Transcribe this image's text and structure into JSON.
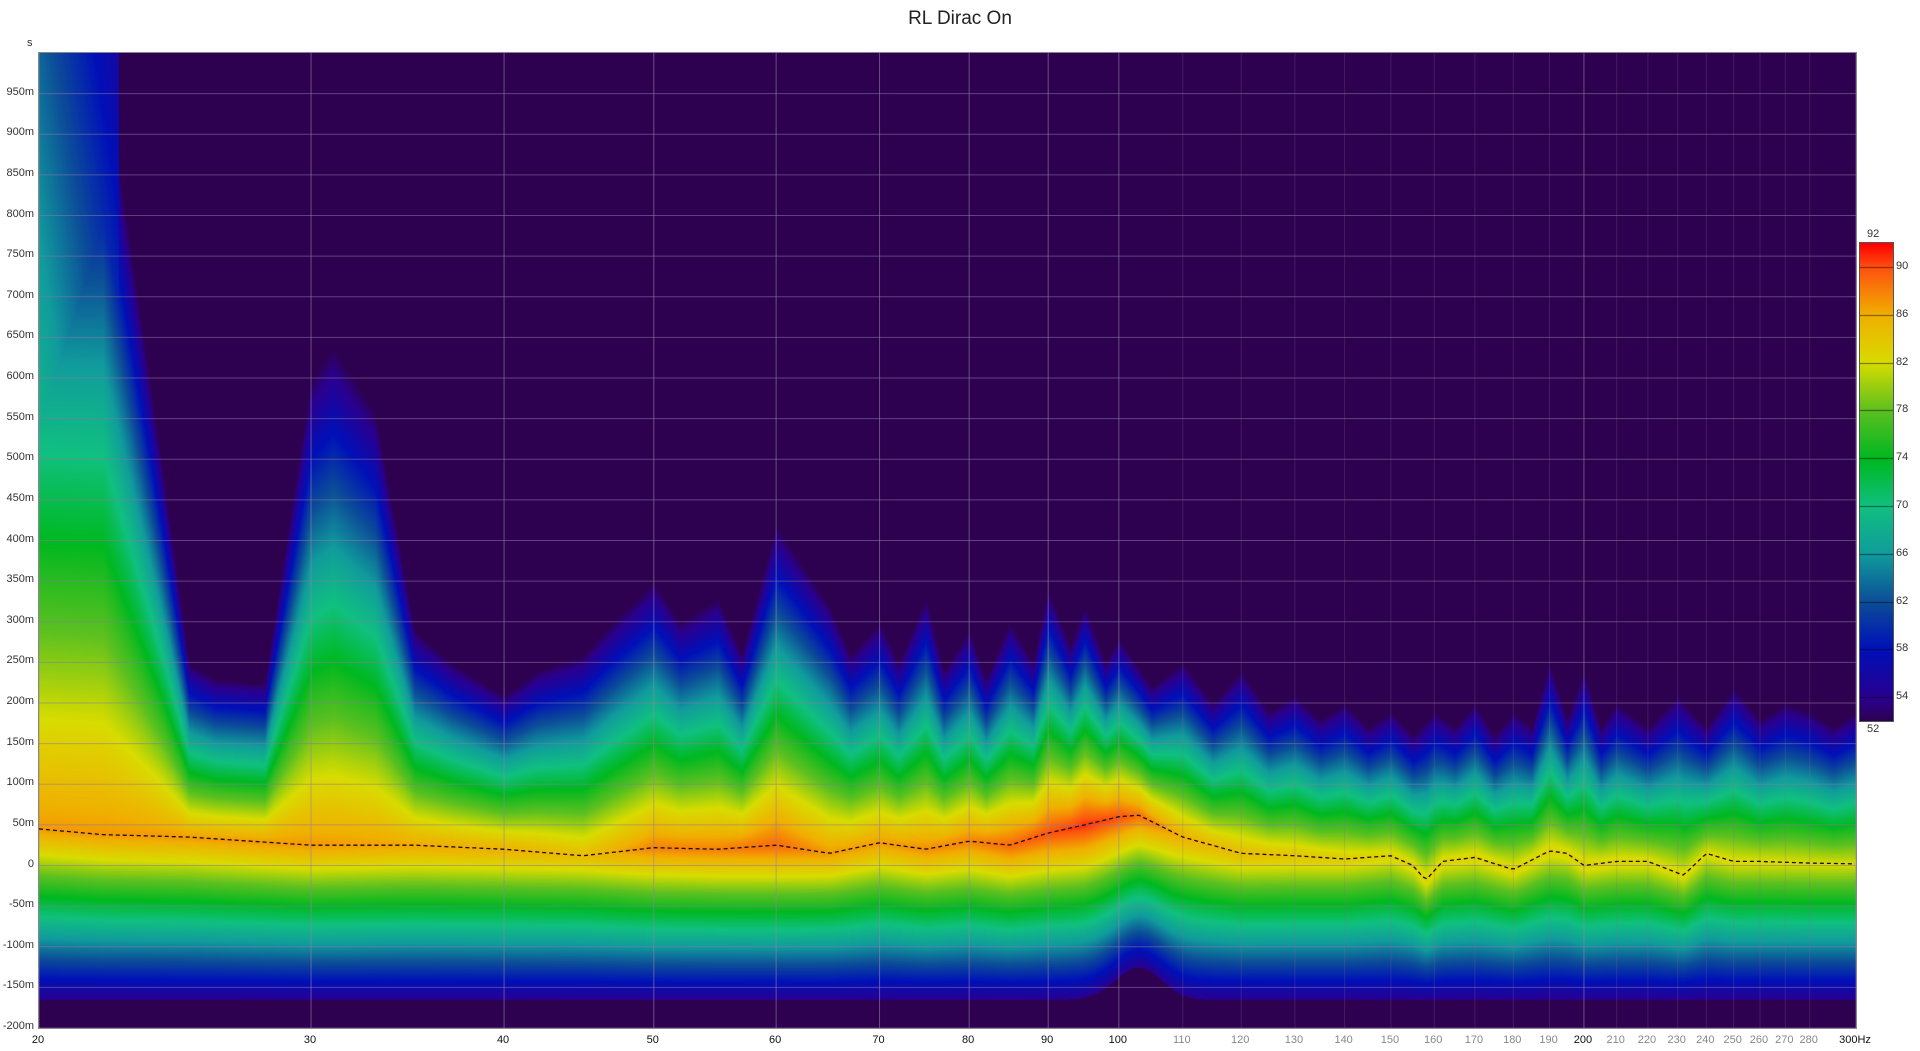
{
  "title": "RL Dirac On",
  "chart_data": {
    "type": "heatmap",
    "title": "RL Dirac On",
    "xlabel": "Hz",
    "ylabel": "s",
    "x_scale": "log",
    "xlim": [
      20,
      300
    ],
    "ylim_ms": [
      -200,
      1000
    ],
    "x_ticks": [
      {
        "v": 20,
        "label": "20",
        "major": true
      },
      {
        "v": 30,
        "label": "30",
        "major": true
      },
      {
        "v": 40,
        "label": "40",
        "major": true
      },
      {
        "v": 50,
        "label": "50",
        "major": true
      },
      {
        "v": 60,
        "label": "60",
        "major": true
      },
      {
        "v": 70,
        "label": "70",
        "major": true
      },
      {
        "v": 80,
        "label": "80",
        "major": true
      },
      {
        "v": 90,
        "label": "90",
        "major": true
      },
      {
        "v": 100,
        "label": "100",
        "major": true
      },
      {
        "v": 110,
        "label": "110"
      },
      {
        "v": 120,
        "label": "120"
      },
      {
        "v": 130,
        "label": "130"
      },
      {
        "v": 140,
        "label": "140"
      },
      {
        "v": 150,
        "label": "150"
      },
      {
        "v": 160,
        "label": "160"
      },
      {
        "v": 170,
        "label": "170"
      },
      {
        "v": 180,
        "label": "180"
      },
      {
        "v": 190,
        "label": "190"
      },
      {
        "v": 200,
        "label": "200",
        "major": true
      },
      {
        "v": 210,
        "label": "210"
      },
      {
        "v": 220,
        "label": "220"
      },
      {
        "v": 230,
        "label": "230"
      },
      {
        "v": 240,
        "label": "240"
      },
      {
        "v": 250,
        "label": "250"
      },
      {
        "v": 260,
        "label": "260"
      },
      {
        "v": 270,
        "label": "270"
      },
      {
        "v": 280,
        "label": "280"
      },
      {
        "v": 300,
        "label": "300Hz",
        "major": true
      }
    ],
    "y_ticks": [
      {
        "v": 950,
        "label": "950m"
      },
      {
        "v": 900,
        "label": "900m"
      },
      {
        "v": 850,
        "label": "850m"
      },
      {
        "v": 800,
        "label": "800m"
      },
      {
        "v": 750,
        "label": "750m"
      },
      {
        "v": 700,
        "label": "700m"
      },
      {
        "v": 650,
        "label": "650m"
      },
      {
        "v": 600,
        "label": "600m"
      },
      {
        "v": 550,
        "label": "550m"
      },
      {
        "v": 500,
        "label": "500m"
      },
      {
        "v": 450,
        "label": "450m"
      },
      {
        "v": 400,
        "label": "400m"
      },
      {
        "v": 350,
        "label": "350m"
      },
      {
        "v": 300,
        "label": "300m"
      },
      {
        "v": 250,
        "label": "250m"
      },
      {
        "v": 200,
        "label": "200m"
      },
      {
        "v": 150,
        "label": "150m"
      },
      {
        "v": 100,
        "label": "100m"
      },
      {
        "v": 50,
        "label": "50m"
      },
      {
        "v": 0,
        "label": "0"
      },
      {
        "v": -50,
        "label": "-50m"
      },
      {
        "v": -100,
        "label": "-100m"
      },
      {
        "v": -150,
        "label": "-150m"
      },
      {
        "v": -200,
        "label": "-200m"
      }
    ],
    "y_unit": "s",
    "colorbar": {
      "range_db": [
        52,
        92
      ],
      "min_label": "52",
      "max_label": "92",
      "ticks": [
        "90",
        "86",
        "82",
        "78",
        "74",
        "70",
        "66",
        "62",
        "58",
        "54"
      ],
      "tick_values": [
        90,
        86,
        82,
        78,
        74,
        70,
        66,
        62,
        58,
        54
      ],
      "colors": [
        [
          52,
          "#2e0050"
        ],
        [
          54,
          "#2a0090"
        ],
        [
          58,
          "#0010b8"
        ],
        [
          62,
          "#0c4e98"
        ],
        [
          66,
          "#109c9c"
        ],
        [
          70,
          "#10c080"
        ],
        [
          74,
          "#00b820"
        ],
        [
          78,
          "#5cc020"
        ],
        [
          82,
          "#d8dc00"
        ],
        [
          86,
          "#f0b000"
        ],
        [
          90,
          "#ff5010"
        ],
        [
          92,
          "#ff0000"
        ]
      ]
    },
    "decay_end_ms": {
      "freq": [
        20,
        21,
        22,
        24,
        25,
        26,
        28,
        30,
        31,
        33,
        35,
        37,
        40,
        42,
        45,
        47,
        50,
        52,
        55,
        57,
        60,
        62,
        65,
        67,
        70,
        72,
        75,
        77,
        80,
        82,
        85,
        88,
        90,
        93,
        95,
        98,
        100,
        105,
        110,
        115,
        120,
        125,
        130,
        135,
        140,
        145,
        150,
        155,
        160,
        165,
        170,
        175,
        180,
        185,
        190,
        195,
        200,
        205,
        210,
        220,
        230,
        240,
        250,
        260,
        270,
        280,
        290,
        300
      ],
      "values": [
        1000,
        1000,
        1000,
        500,
        250,
        230,
        225,
        600,
        640,
        560,
        290,
        250,
        210,
        240,
        260,
        300,
        350,
        300,
        330,
        260,
        420,
        380,
        320,
        260,
        300,
        250,
        330,
        240,
        290,
        230,
        300,
        250,
        340,
        270,
        320,
        250,
        280,
        220,
        250,
        200,
        240,
        190,
        210,
        180,
        200,
        170,
        190,
        160,
        190,
        170,
        200,
        160,
        190,
        170,
        250,
        180,
        240,
        170,
        200,
        170,
        210,
        170,
        220,
        180,
        200,
        190,
        170,
        190
      ]
    },
    "peak_level_db": {
      "freq": [
        20,
        25,
        30,
        40,
        45,
        50,
        55,
        60,
        65,
        70,
        80,
        90,
        95,
        100,
        105,
        110,
        120,
        150,
        200,
        300
      ],
      "values": [
        87,
        87,
        87,
        86,
        85,
        88,
        88,
        89,
        87,
        87,
        88,
        90,
        91,
        90,
        88,
        86,
        85,
        83,
        83,
        82
      ]
    },
    "peak_time_line_ms": {
      "freq": [
        20,
        22,
        25,
        30,
        35,
        40,
        45,
        50,
        55,
        60,
        65,
        70,
        75,
        80,
        85,
        90,
        95,
        100,
        103,
        110,
        120,
        130,
        140,
        150,
        155,
        158,
        162,
        170,
        180,
        190,
        195,
        200,
        210,
        220,
        232,
        240,
        250,
        260,
        280,
        300
      ],
      "values": [
        45,
        38,
        35,
        25,
        25,
        20,
        12,
        22,
        20,
        25,
        15,
        28,
        20,
        30,
        25,
        40,
        50,
        60,
        62,
        35,
        15,
        12,
        8,
        12,
        0,
        -18,
        5,
        10,
        -5,
        18,
        15,
        0,
        5,
        5,
        -12,
        15,
        5,
        5,
        3,
        2
      ]
    }
  }
}
